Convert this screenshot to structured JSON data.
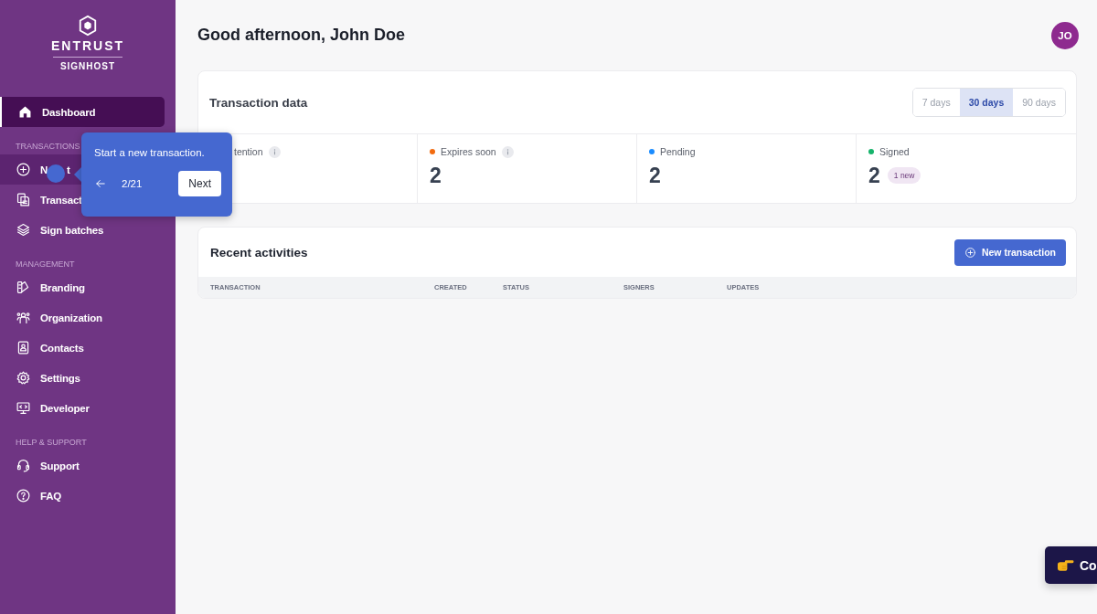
{
  "sidebar": {
    "logo": {
      "brand": "ENTRUST",
      "product": "SIGNHOST"
    },
    "items": [
      {
        "kind": "item",
        "label": "Dashboard",
        "selected": true,
        "highlighted": false
      },
      {
        "kind": "section",
        "label": "TRANSACTIONS"
      },
      {
        "kind": "item",
        "label": "N",
        "label_tail": "t",
        "selected": false,
        "highlighted": true
      },
      {
        "kind": "item",
        "label": "Transact",
        "selected": false,
        "highlighted": false
      },
      {
        "kind": "item",
        "label": "Sign batches",
        "selected": false,
        "highlighted": false
      },
      {
        "kind": "section",
        "label": "MANAGEMENT"
      },
      {
        "kind": "item",
        "label": "Branding",
        "selected": false,
        "highlighted": false
      },
      {
        "kind": "item",
        "label": "Organization",
        "selected": false,
        "highlighted": false
      },
      {
        "kind": "item",
        "label": "Contacts",
        "selected": false,
        "highlighted": false
      },
      {
        "kind": "item",
        "label": "Settings",
        "selected": false,
        "highlighted": false
      },
      {
        "kind": "item",
        "label": "Developer",
        "selected": false,
        "highlighted": false
      },
      {
        "kind": "section",
        "label": "HELP & SUPPORT"
      },
      {
        "kind": "item",
        "label": "Support",
        "selected": false,
        "highlighted": false
      },
      {
        "kind": "item",
        "label": "FAQ",
        "selected": false,
        "highlighted": false
      }
    ]
  },
  "tour_tooltip": {
    "text": "Start a new transaction.",
    "step": "2/21",
    "next": "Next"
  },
  "greeting": "Good afternoon, John Doe",
  "avatar": "JO",
  "transaction_data": {
    "title": "Transaction data",
    "ranges": [
      {
        "label": "7 days",
        "selected": false
      },
      {
        "label": "30 days",
        "selected": true
      },
      {
        "label": "90 days",
        "selected": false
      }
    ],
    "stats": [
      {
        "label": "tention",
        "info": true
      },
      {
        "label": "Expires soon",
        "color": "#f26b0f",
        "value": "2",
        "info": true
      },
      {
        "label": "Pending",
        "color": "#1a8cff",
        "value": "2"
      },
      {
        "label": "Signed",
        "color": "#16b36b",
        "value": "2",
        "badge": "1 new"
      }
    ]
  },
  "recent_activities": {
    "title": "Recent activities",
    "button": "New transaction",
    "columns": [
      "TRANSACTION",
      "CREATED",
      "STATUS",
      "SIGNERS",
      "UPDATES"
    ]
  },
  "corner_button": {
    "label": "Co"
  }
}
